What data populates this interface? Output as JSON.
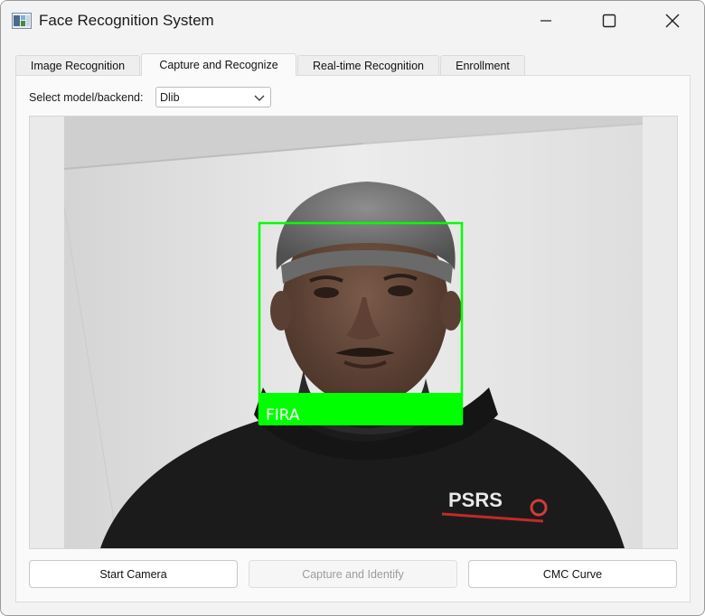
{
  "window": {
    "title": "Face Recognition System"
  },
  "tabs": [
    {
      "label": "Image Recognition",
      "active": false
    },
    {
      "label": "Capture and Recognize",
      "active": true
    },
    {
      "label": "Real-time Recognition",
      "active": false
    },
    {
      "label": "Enrollment",
      "active": false
    }
  ],
  "model_select": {
    "label": "Select model/backend:",
    "value": "Dlib"
  },
  "camera": {
    "detected_name": "FIRA",
    "box_color": "#00ff00",
    "hoodie_logo_text": "PSRS"
  },
  "buttons": {
    "start_camera": "Start Camera",
    "capture_identify": "Capture and Identify",
    "cmc_curve": "CMC Curve"
  },
  "colors": {
    "window_bg": "#f3f3f3",
    "detection_green": "#00ff00"
  }
}
